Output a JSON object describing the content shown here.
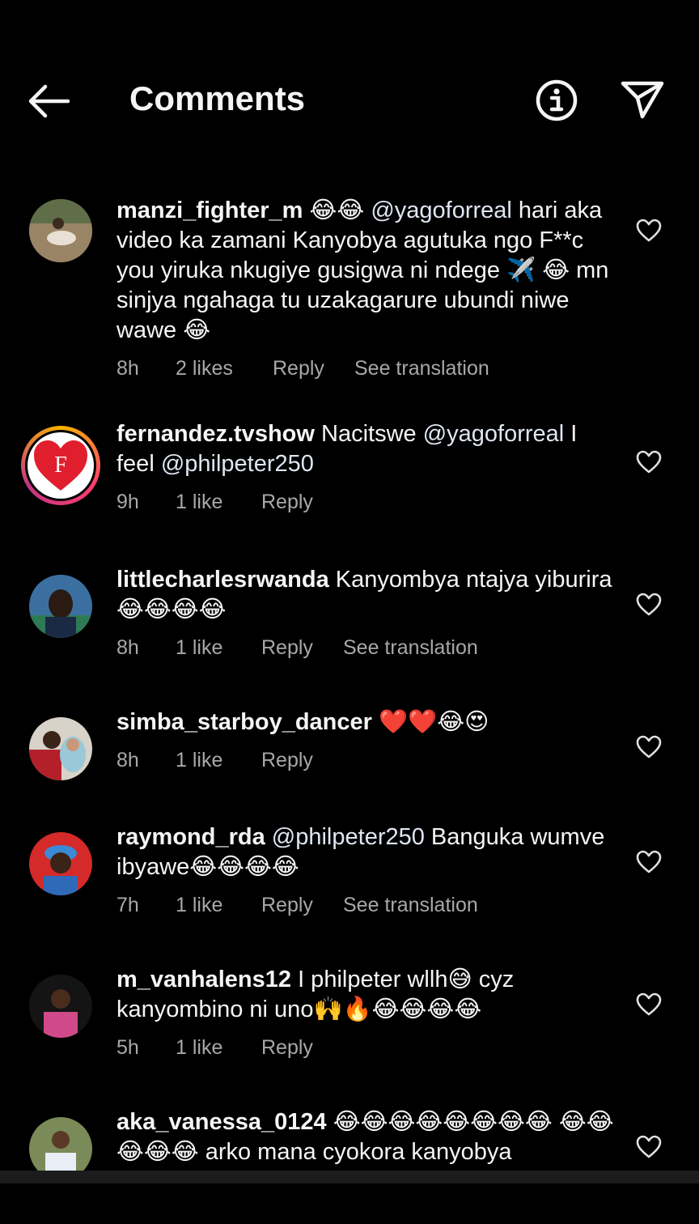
{
  "header": {
    "title": "Comments",
    "back_icon": "arrow-left-icon",
    "info_icon": "info-circle-icon",
    "share_icon": "paper-plane-icon"
  },
  "comments": [
    {
      "username": "manzi_fighter_m",
      "segments": [
        {
          "t": "text",
          "v": " 😂😂 "
        },
        {
          "t": "mention",
          "v": "@yagoforreal"
        },
        {
          "t": "text",
          "v": " hari aka video ka zamani Kanyobya agutuka ngo F**c you yiruka nkugiye gusigwa ni ndege ✈️ 😂 mn sinjya ngahaga tu uzakagarure ubundi niwe wawe 😂"
        }
      ],
      "time": "8h",
      "likes": "2 likes",
      "reply": "Reply",
      "translate": "See translation"
    },
    {
      "username": "fernandez.tvshow",
      "segments": [
        {
          "t": "text",
          "v": " Nacitswe "
        },
        {
          "t": "mention",
          "v": "@yagoforreal"
        },
        {
          "t": "text",
          "v": " I feel "
        },
        {
          "t": "mention",
          "v": "@philpeter250"
        }
      ],
      "time": "9h",
      "likes": "1 like",
      "reply": "Reply",
      "translate": ""
    },
    {
      "username": "littlecharlesrwanda",
      "segments": [
        {
          "t": "text",
          "v": " Kanyombya ntajya yiburira 😂😂😂😂"
        }
      ],
      "time": "8h",
      "likes": "1 like",
      "reply": "Reply",
      "translate": "See translation"
    },
    {
      "username": "simba_starboy_dancer",
      "segments": [
        {
          "t": "text",
          "v": " ❤️❤️😂😍"
        }
      ],
      "time": "8h",
      "likes": "1 like",
      "reply": "Reply",
      "translate": ""
    },
    {
      "username": "raymond_rda",
      "segments": [
        {
          "t": "text",
          "v": " "
        },
        {
          "t": "mention",
          "v": "@philpeter250"
        },
        {
          "t": "text",
          "v": "  Banguka wumve ibyawe😂😂😂😂"
        }
      ],
      "time": "7h",
      "likes": "1 like",
      "reply": "Reply",
      "translate": "See translation"
    },
    {
      "username": "m_vanhalens12",
      "segments": [
        {
          "t": "text",
          "v": " I philpeter wllh😅 cyz kanyombino ni uno🙌🔥😂😂😂😂"
        }
      ],
      "time": "5h",
      "likes": "1 like",
      "reply": "Reply",
      "translate": ""
    },
    {
      "username": "aka_vanessa_0124",
      "segments": [
        {
          "t": "text",
          "v": " 😂😂😂😂😂😂😂😂 😂😂😂😂😂 arko mana cyokora kanyobya"
        }
      ],
      "time": "",
      "likes": "",
      "reply": "",
      "translate": ""
    }
  ],
  "colors": {
    "background": "#000000",
    "text": "#f5f5f5",
    "meta": "#a8a8a8"
  },
  "fernandez_avatar_text": "F"
}
